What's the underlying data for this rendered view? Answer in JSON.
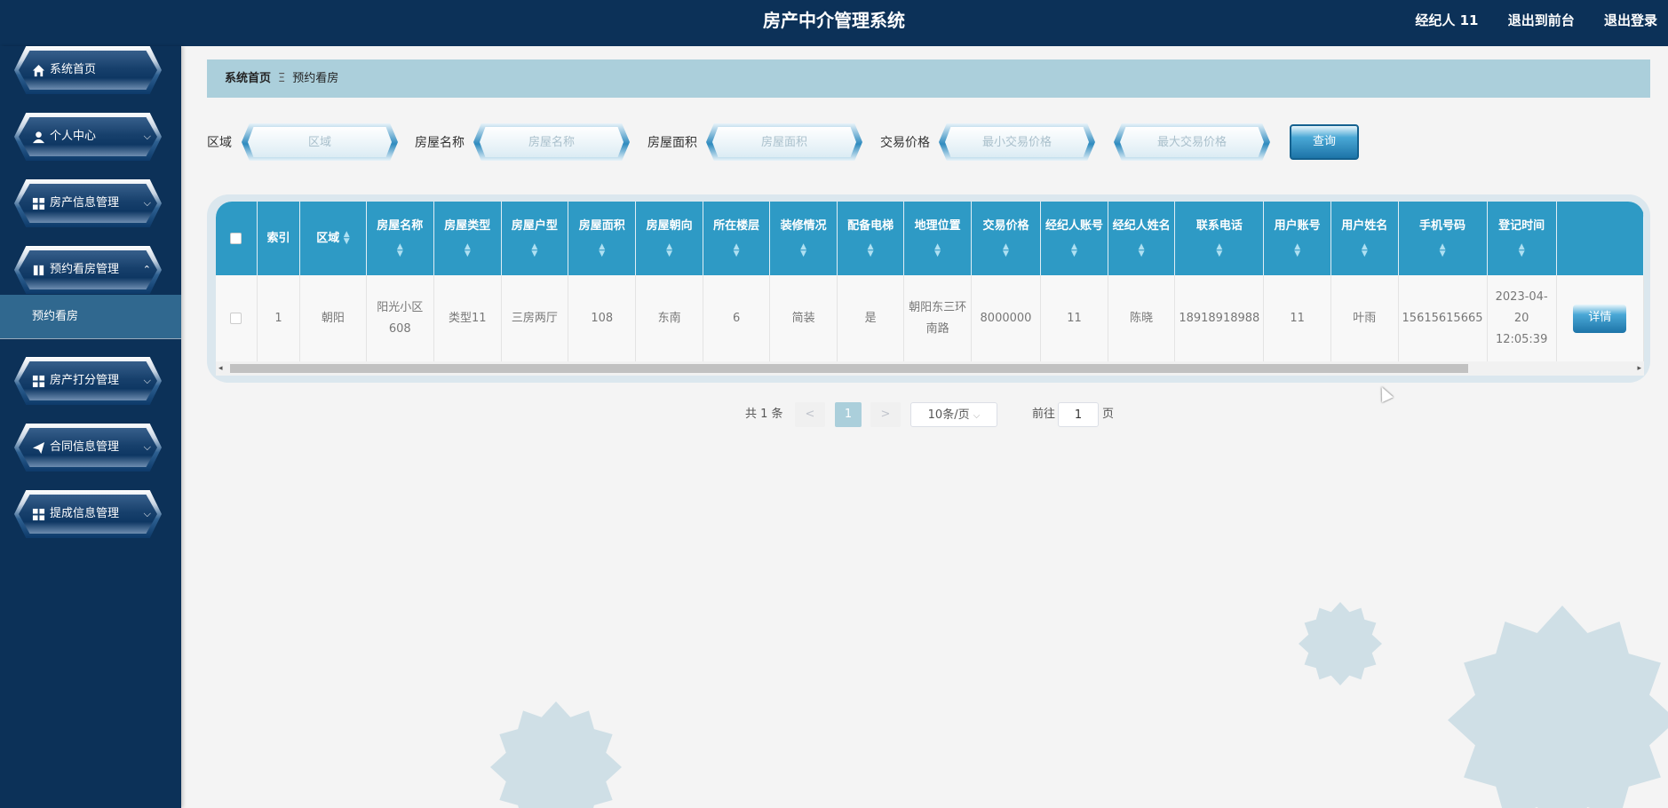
{
  "header": {
    "title": "房产中介管理系统",
    "user": "经纪人 11",
    "back_front": "退出到前台",
    "logout": "退出登录"
  },
  "sidebar": {
    "items": [
      {
        "label": "系统首页",
        "icon": "home-icon"
      },
      {
        "label": "个人中心",
        "icon": "user-icon"
      },
      {
        "label": "房产信息管理",
        "icon": "grid-icon"
      },
      {
        "label": "预约看房管理",
        "icon": "book-icon",
        "expanded": true
      },
      {
        "label": "房产打分管理",
        "icon": "grid-icon"
      },
      {
        "label": "合同信息管理",
        "icon": "send-icon"
      },
      {
        "label": "提成信息管理",
        "icon": "grid-icon"
      }
    ],
    "sub_item": "预约看房"
  },
  "breadcrumb": {
    "home": "系统首页",
    "sep": "Ξ",
    "current": "预约看房"
  },
  "search": {
    "area_label": "区域",
    "area_placeholder": "区域",
    "name_label": "房屋名称",
    "name_placeholder": "房屋名称",
    "size_label": "房屋面积",
    "size_placeholder": "房屋面积",
    "price_label": "交易价格",
    "min_price_placeholder": "最小交易价格",
    "max_price_placeholder": "最大交易价格",
    "query_button": "查询"
  },
  "table": {
    "headers": [
      "索引",
      "区域",
      "房屋名称",
      "房屋类型",
      "房屋户型",
      "房屋面积",
      "房屋朝向",
      "所在楼层",
      "装修情况",
      "配备电梯",
      "地理位置",
      "交易价格",
      "经纪人账号",
      "经纪人姓名",
      "联系电话",
      "用户账号",
      "用户姓名",
      "手机号码",
      "登记时间"
    ],
    "rows": [
      [
        "1",
        "朝阳",
        "阳光小区608",
        "类型11",
        "三房两厅",
        "108",
        "东南",
        "6",
        "简装",
        "是",
        "朝阳东三环南路",
        "8000000",
        "11",
        "陈晓",
        "18918918988",
        "11",
        "叶雨",
        "15615615665",
        "2023-04-20 12:05:39"
      ]
    ],
    "detail_button": "详情"
  },
  "pagination": {
    "total": "共 1 条",
    "prev": "<",
    "current": "1",
    "next": ">",
    "page_size": "10条/页",
    "goto_label": "前往",
    "goto_value": "1",
    "page_suffix": "页"
  },
  "colors": {
    "header_bg": "#0c3158",
    "accent": "#2e9ac5",
    "breadcrumb_bg": "#abcfdb"
  }
}
